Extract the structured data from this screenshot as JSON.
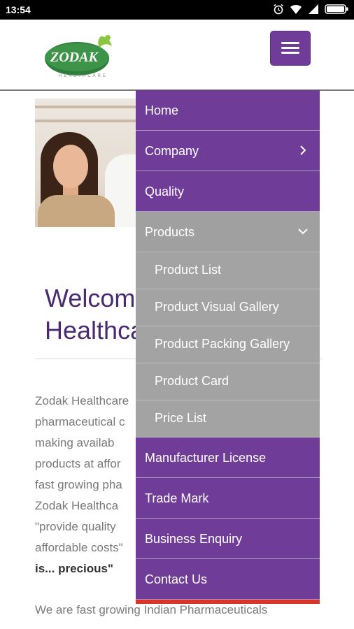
{
  "status_bar": {
    "time": "13:54"
  },
  "logo": {
    "name": "ZODAK",
    "tagline": "HEALTHCARE"
  },
  "welcome": {
    "line1": "Welcome",
    "line2": "Healthcare"
  },
  "intro_lines": [
    "Zodak    Healthcare",
    "pharmaceutical c",
    "making      availab",
    "products at affor",
    "fast growing pha",
    "Zodak    Healthca",
    "\"provide  quality",
    "affordable costs\""
  ],
  "quote_end": "is... precious\"",
  "para2_first_line": "We  are  fast  growing  Indian  Pharmaceuticals",
  "menu": {
    "items": [
      {
        "label": "Home"
      },
      {
        "label": "Company"
      },
      {
        "label": "Quality"
      },
      {
        "label": "Products"
      },
      {
        "label": "Manufacturer License"
      },
      {
        "label": "Trade Mark"
      },
      {
        "label": "Business Enquiry"
      },
      {
        "label": "Contact Us"
      }
    ],
    "products_submenu": [
      {
        "label": "Product List"
      },
      {
        "label": "Product Visual Gallery"
      },
      {
        "label": "Product Packing Gallery"
      },
      {
        "label": "Product Card"
      },
      {
        "label": "Price List"
      }
    ]
  },
  "colors": {
    "menu_purple": "#6f3d97",
    "submenu_gray": "#a3a3a3",
    "accent_red": "#d9342b",
    "heading_purple": "#4a2a70"
  }
}
